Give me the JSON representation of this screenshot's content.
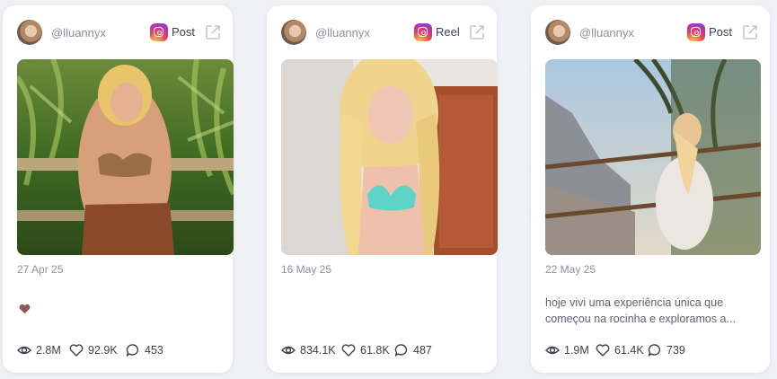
{
  "posts": [
    {
      "handle": "@lluannyx",
      "type": "Post",
      "date": "27 Apr 25",
      "caption": "",
      "caption_icon": "heart-emoji",
      "views": "2.8M",
      "likes": "92.9K",
      "comments": "453"
    },
    {
      "handle": "@lluannyx",
      "type": "Reel",
      "date": "16 May 25",
      "caption": "",
      "views": "834.1K",
      "likes": "61.8K",
      "comments": "487"
    },
    {
      "handle": "@lluannyx",
      "type": "Post",
      "date": "22 May 25",
      "caption": "hoje vivi uma experiência única que começou na rocinha e exploramos a...",
      "views": "1.9M",
      "likes": "61.4K",
      "comments": "739"
    }
  ],
  "icons": {
    "platform": "instagram-icon",
    "open": "external-link-icon",
    "views": "eye-icon",
    "likes": "heart-icon",
    "comments": "comment-icon"
  },
  "colors": {
    "card": "#ffffff",
    "background": "#eef0f4",
    "muted_text": "#8b90a0",
    "text": "#3b3f4d"
  }
}
